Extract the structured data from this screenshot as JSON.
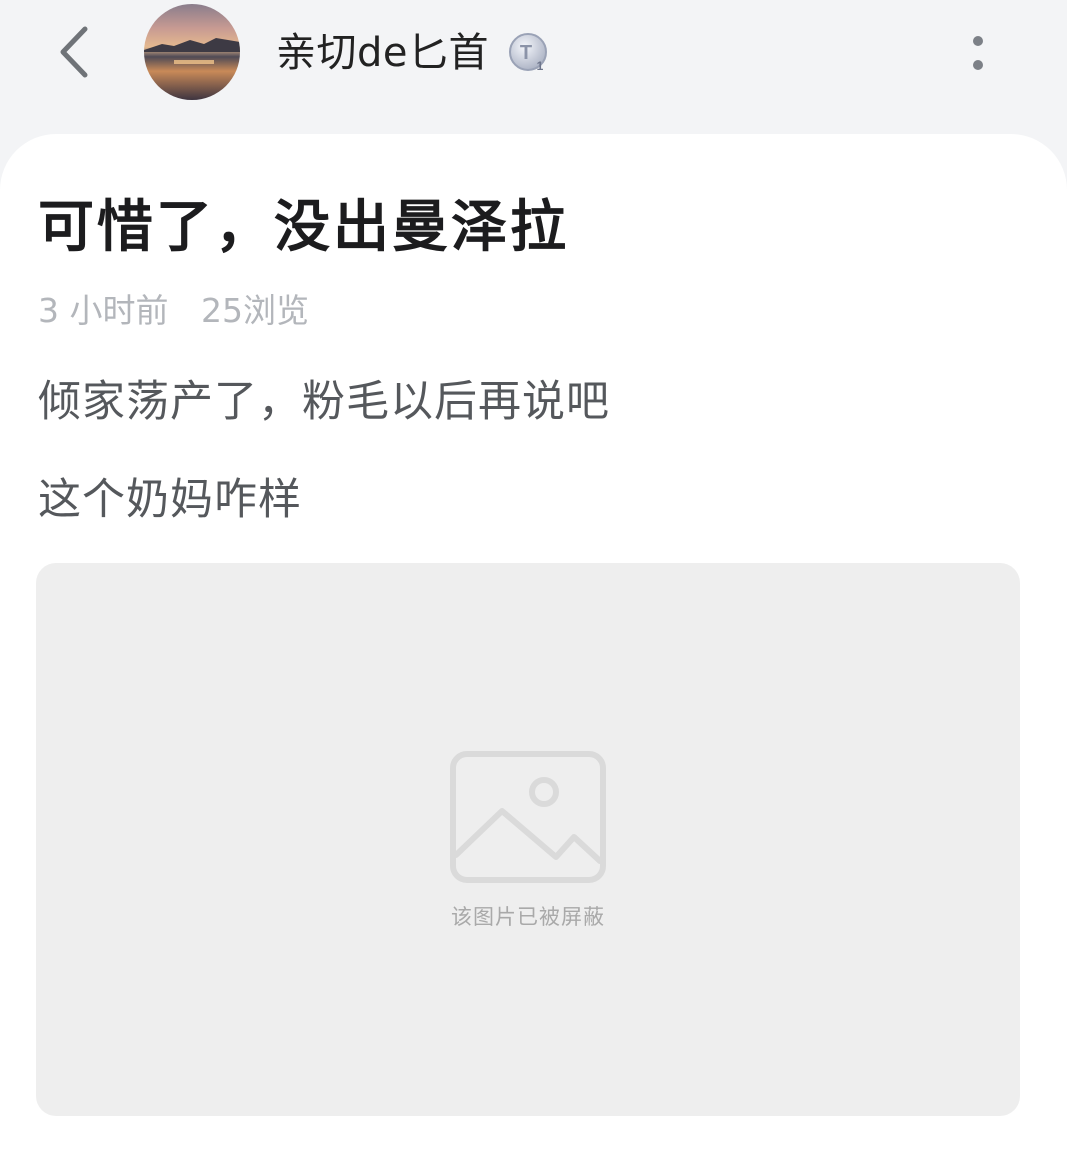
{
  "header": {
    "back_icon": "chevron-left-icon",
    "username": "亲切de匕首",
    "badge_icon": "level-badge-icon",
    "badge_letter": "T",
    "badge_level": "1",
    "more_icon": "more-vertical-icon"
  },
  "post": {
    "title": "可惜了，没出曼泽拉",
    "time": "3 小时前",
    "views": "25浏览",
    "lines": [
      "倾家荡产了，粉毛以后再说吧",
      "这个奶妈咋样"
    ],
    "image_blocked_text": "该图片已被屏蔽",
    "image_placeholder_icon": "image-placeholder-icon"
  },
  "colors": {
    "page_bg": "#f3f4f6",
    "card_bg": "#ffffff",
    "title": "#1c1c1e",
    "meta": "#b3b6bb",
    "body_text": "#55585c",
    "placeholder_bg": "#eeeeee"
  }
}
